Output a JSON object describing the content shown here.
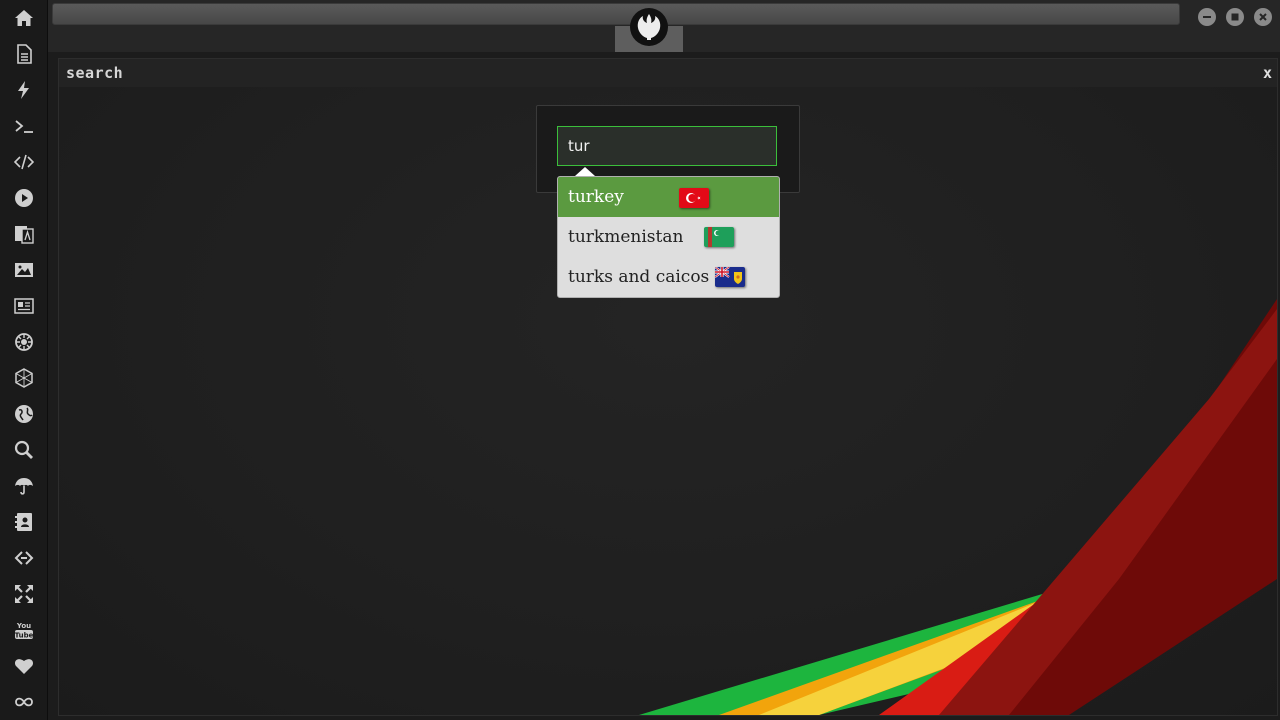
{
  "panel": {
    "title": "search",
    "close_label": "x"
  },
  "search": {
    "value": "tur"
  },
  "suggestions": [
    {
      "label": "turkey",
      "flag": "turkey-flag-icon",
      "selected": true
    },
    {
      "label": "turkmenistan",
      "flag": "turkmenistan-flag-icon",
      "selected": false
    },
    {
      "label": "turks and caicos",
      "flag": "turks-and-caicos-flag-icon",
      "selected": false
    }
  ],
  "sidebar": {
    "items": [
      "home-icon",
      "document-icon",
      "lightning-icon",
      "terminal-icon",
      "code-icon",
      "play-icon",
      "translate-icon",
      "image-icon",
      "news-icon",
      "settings-wheel-icon",
      "hexagon-icon",
      "globe-icon",
      "search-icon",
      "umbrella-icon",
      "contacts-icon",
      "link-icon",
      "expand-icon",
      "youtube-icon",
      "heart-icon",
      "infinity-icon"
    ]
  },
  "colors": {
    "accent_green": "#5b9a40",
    "input_border": "#3bbf3b",
    "background": "#1f1f1f"
  }
}
